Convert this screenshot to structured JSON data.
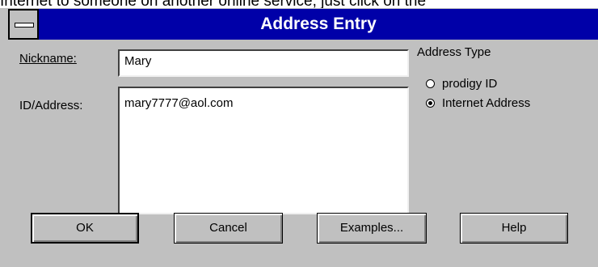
{
  "background_text": "Internet to someone on another online service, just click on the",
  "window": {
    "title": "Address Entry"
  },
  "form": {
    "nickname_label": "Nickname:",
    "nickname_value": "Mary",
    "address_label": "ID/Address:",
    "address_value": "mary7777@aol.com"
  },
  "address_type": {
    "heading": "Address Type",
    "options": [
      {
        "label": "prodigy ID",
        "selected": false
      },
      {
        "label": "Internet Address",
        "selected": true
      }
    ]
  },
  "buttons": {
    "ok": "OK",
    "cancel": "Cancel",
    "examples": "Examples...",
    "help": "Help"
  },
  "colors": {
    "titlebar": "#0000a8",
    "face": "#c0c0c0"
  }
}
